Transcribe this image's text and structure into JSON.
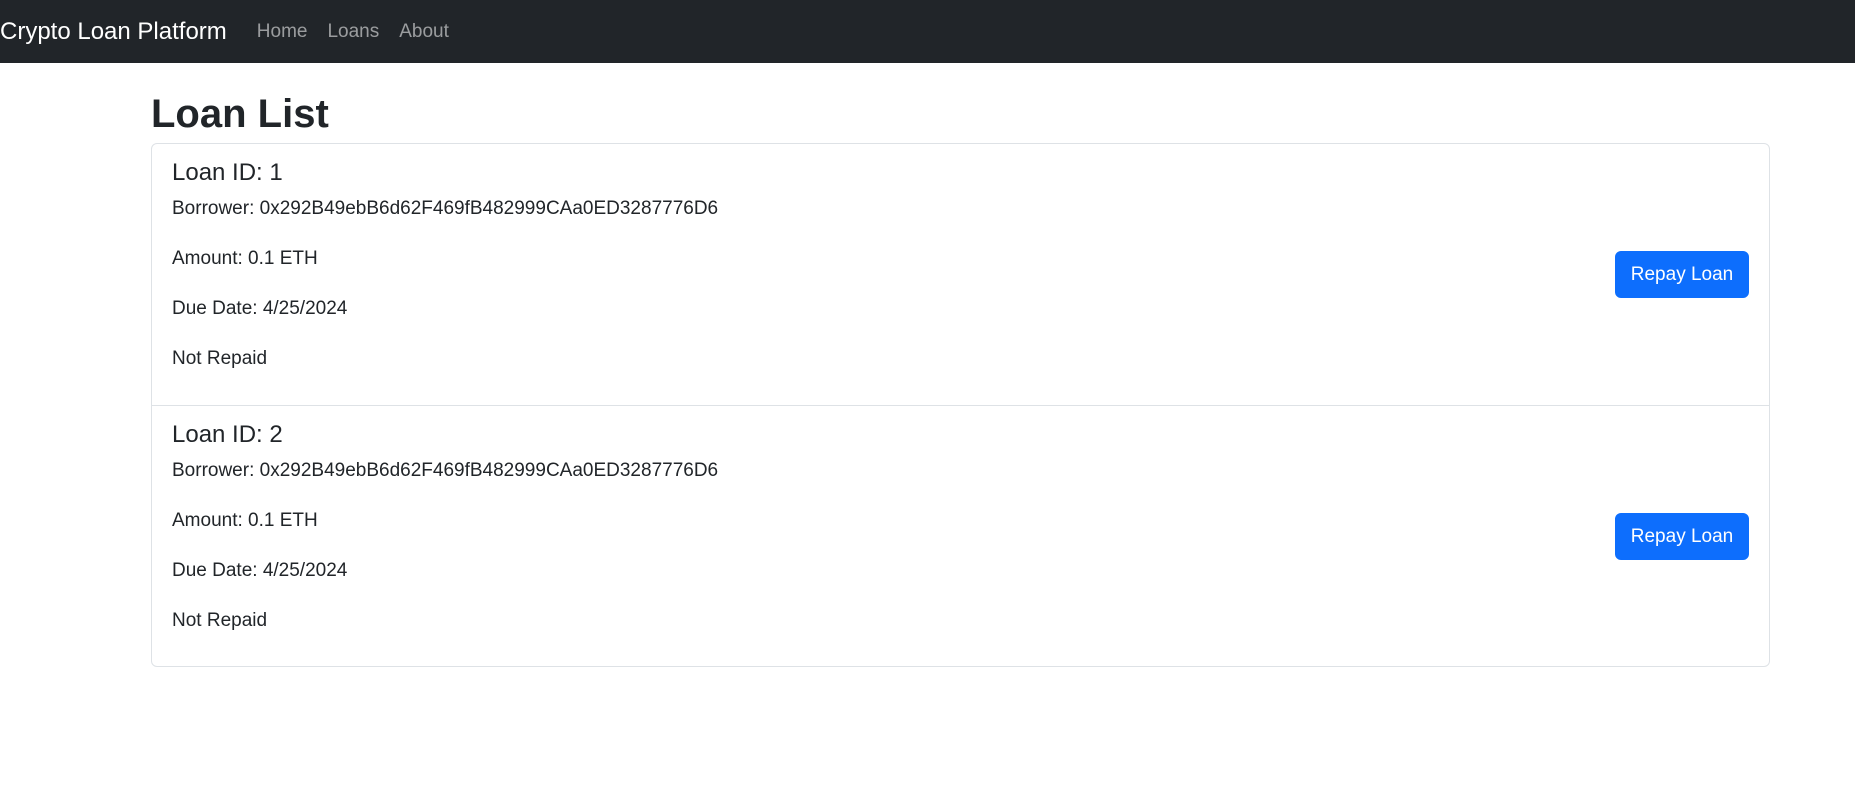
{
  "navbar": {
    "brand": "Crypto Loan Platform",
    "links": [
      "Home",
      "Loans",
      "About"
    ]
  },
  "page": {
    "title": "Loan List"
  },
  "loans": [
    {
      "title": "Loan ID: 1",
      "borrower": "Borrower: 0x292B49ebB6d62F469fB482999CAa0ED3287776D6",
      "amount": "Amount: 0.1 ETH",
      "due_date": "Due Date: 4/25/2024",
      "status": "Not Repaid",
      "button_label": "Repay Loan"
    },
    {
      "title": "Loan ID: 2",
      "borrower": "Borrower: 0x292B49ebB6d62F469fB482999CAa0ED3287776D6",
      "amount": "Amount: 0.1 ETH",
      "due_date": "Due Date: 4/25/2024",
      "status": "Not Repaid",
      "button_label": "Repay Loan"
    }
  ],
  "colors": {
    "navbar_bg": "#212529",
    "primary": "#0d6efd",
    "border": "#dee2e6"
  }
}
